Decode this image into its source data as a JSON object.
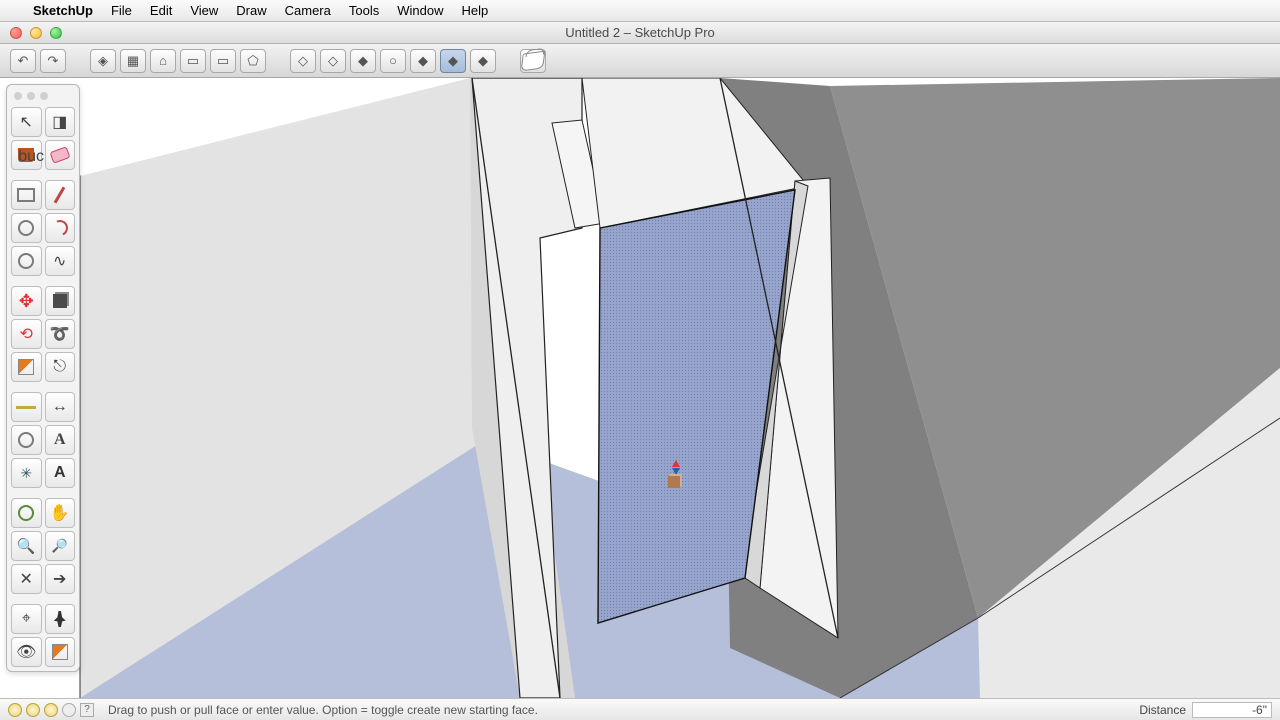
{
  "menubar": {
    "app": "SketchUp",
    "items": [
      "File",
      "Edit",
      "View",
      "Draw",
      "Camera",
      "Tools",
      "Window",
      "Help"
    ]
  },
  "window": {
    "title": "Untitled 2 – SketchUp Pro"
  },
  "toolbar": {
    "groups": [
      {
        "name": "nav-history",
        "buttons": [
          {
            "name": "undo",
            "glyph": "↶"
          },
          {
            "name": "redo",
            "glyph": "↷"
          }
        ]
      },
      {
        "name": "std-views",
        "buttons": [
          {
            "name": "iso-view",
            "glyph": "◈"
          },
          {
            "name": "top-view",
            "glyph": "▦"
          },
          {
            "name": "front-view",
            "glyph": "⌂"
          },
          {
            "name": "right-view",
            "glyph": "▭"
          },
          {
            "name": "back-view",
            "glyph": "▭"
          },
          {
            "name": "left-view",
            "glyph": "⬠"
          }
        ]
      },
      {
        "name": "face-styles",
        "buttons": [
          {
            "name": "xray",
            "glyph": "◇"
          },
          {
            "name": "wireframe",
            "glyph": "◇"
          },
          {
            "name": "hiddenline",
            "glyph": "◆"
          },
          {
            "name": "shaded",
            "glyph": "○"
          },
          {
            "name": "shaded-tex",
            "glyph": "◆"
          },
          {
            "name": "monochrome",
            "glyph": "◆",
            "active": true
          },
          {
            "name": "styles",
            "glyph": "◆"
          }
        ]
      },
      {
        "name": "materials",
        "buttons": [
          {
            "name": "paint-bucket",
            "glyph": "bucket"
          }
        ]
      }
    ]
  },
  "palette": {
    "tools": [
      {
        "name": "select",
        "glyph": "↖"
      },
      {
        "name": "make-comp",
        "glyph": "◨"
      },
      {
        "name": "paint",
        "glyph": "bucket",
        "cls": "ic-bucket"
      },
      {
        "name": "eraser",
        "cls": "ic-eraser"
      },
      {
        "sep": true
      },
      {
        "name": "rectangle",
        "cls": "ic-rect"
      },
      {
        "name": "line",
        "cls": "ic-pencil"
      },
      {
        "name": "circle",
        "cls": "ic-circle"
      },
      {
        "name": "arc",
        "cls": "ic-arc"
      },
      {
        "name": "polygon",
        "cls": "ic-circle"
      },
      {
        "name": "freehand",
        "glyph": "∿"
      },
      {
        "sep": true
      },
      {
        "name": "move",
        "glyph": "✥",
        "cls": "ic-move"
      },
      {
        "name": "pushpull",
        "cls": "ic-pushpull"
      },
      {
        "name": "rotate",
        "glyph": "⟲",
        "cls": "ic-rotate"
      },
      {
        "name": "followme",
        "glyph": "➰"
      },
      {
        "name": "scale",
        "cls": "ic-section"
      },
      {
        "name": "offset",
        "glyph": "⎋"
      },
      {
        "sep": true
      },
      {
        "name": "tape",
        "cls": "ic-tape"
      },
      {
        "name": "dimension",
        "glyph": "↔"
      },
      {
        "name": "protractor",
        "cls": "ic-circle"
      },
      {
        "name": "text",
        "glyph": "A",
        "cls": "ic-text"
      },
      {
        "name": "axes",
        "glyph": "✳",
        "cls": "ic-axes"
      },
      {
        "name": "3dtext",
        "glyph": "A",
        "cls": "ic-3dtext"
      },
      {
        "sep": true
      },
      {
        "name": "orbit",
        "cls": "ic-orbit"
      },
      {
        "name": "pan",
        "glyph": "✋"
      },
      {
        "name": "zoom",
        "glyph": "🔍",
        "cls": "ic-zoom"
      },
      {
        "name": "zoom-ext",
        "glyph": "🔎",
        "cls": "ic-zoome"
      },
      {
        "name": "prev-view",
        "glyph": "✕"
      },
      {
        "name": "next-view",
        "glyph": "➔"
      },
      {
        "sep": true
      },
      {
        "name": "position-cam",
        "glyph": "⌖"
      },
      {
        "name": "walk",
        "cls": "ic-walk"
      },
      {
        "name": "lookaround",
        "glyph": "👁"
      },
      {
        "name": "section",
        "cls": "ic-section"
      }
    ]
  },
  "status": {
    "hint": "Drag to push or pull face or enter value.  Option = toggle create new starting face.",
    "vcb_label": "Distance",
    "vcb_value": "-6\""
  }
}
